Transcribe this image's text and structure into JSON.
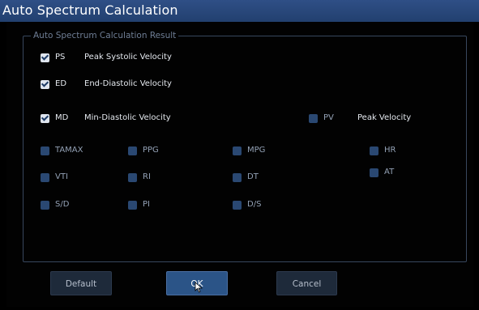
{
  "window": {
    "title": "Auto Spectrum Calculation"
  },
  "group": {
    "label": "Auto Spectrum Calculation Result"
  },
  "options": {
    "ps": {
      "abbr": "PS",
      "label": "Peak Systolic Velocity",
      "checked": true
    },
    "ed": {
      "abbr": "ED",
      "label": "End-Diastolic Velocity",
      "checked": true
    },
    "md": {
      "abbr": "MD",
      "label": "Min-Diastolic Velocity",
      "checked": true
    },
    "pv": {
      "abbr": "PV",
      "label": "Peak Velocity",
      "checked": false
    },
    "tamax": {
      "abbr": "TAMAX",
      "checked": false
    },
    "ppg": {
      "abbr": "PPG",
      "checked": false
    },
    "mpg": {
      "abbr": "MPG",
      "checked": false
    },
    "hr": {
      "abbr": "HR",
      "checked": false
    },
    "at": {
      "abbr": "AT",
      "checked": false
    },
    "vti": {
      "abbr": "VTI",
      "checked": false
    },
    "ri": {
      "abbr": "RI",
      "checked": false
    },
    "dt": {
      "abbr": "DT",
      "checked": false
    },
    "sd": {
      "abbr": "S/D",
      "checked": false
    },
    "pi": {
      "abbr": "PI",
      "checked": false
    },
    "ds": {
      "abbr": "D/S",
      "checked": false
    }
  },
  "buttons": {
    "default": "Default",
    "ok": "OK",
    "cancel": "Cancel"
  },
  "colors": {
    "title_bar": "#2f4f86",
    "checked_box": "#dfe5ee",
    "unchecked_box": "#2a4872",
    "ok_button": "#2b5487",
    "group_border": "#38475e"
  }
}
